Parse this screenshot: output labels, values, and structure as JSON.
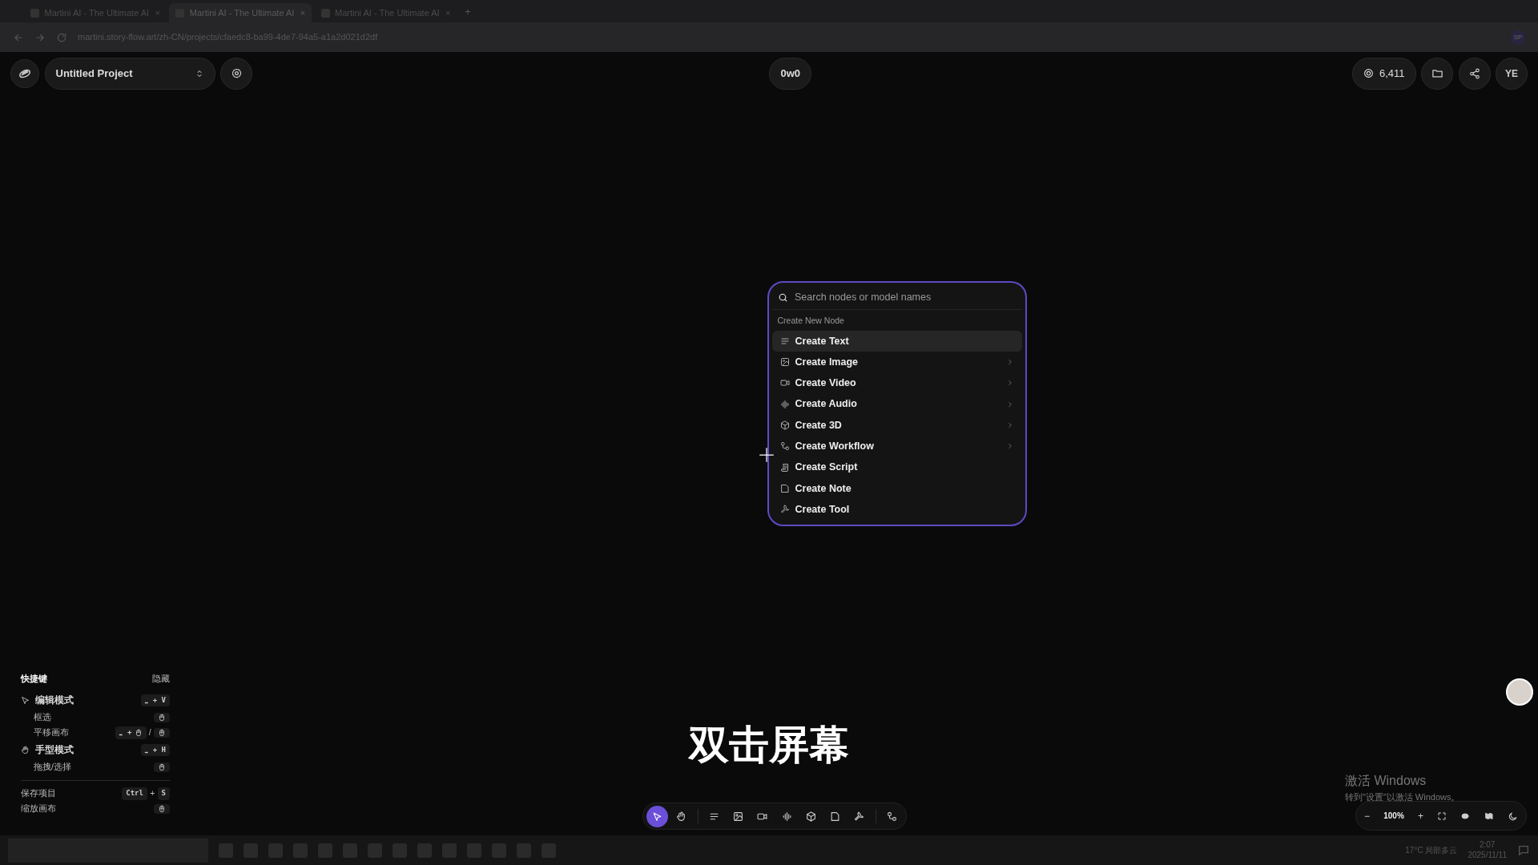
{
  "browser": {
    "tabs": [
      {
        "title": "Martini AI - The Ultimate AI",
        "close": "×",
        "selected": false
      },
      {
        "title": "Martini AI - The Ultimate AI",
        "close": "×",
        "selected": true
      },
      {
        "title": "Martini AI - The Ultimate AI",
        "close": "×",
        "selected": false
      }
    ],
    "new_tab": "+",
    "url": "martini.story-flow.art/zh-CN/projects/cfaedc8-ba99-4de7-94a5-a1a2d021d2df",
    "profile": "SP"
  },
  "header": {
    "project": "Untitled Project",
    "center_badge": "0w0",
    "credits": "6,411",
    "user": "YE"
  },
  "node_menu": {
    "placeholder": "Search nodes or model names",
    "section": "Create New Node",
    "items": [
      {
        "kind": "text",
        "label": "Create Text",
        "submenu": false,
        "selected": true
      },
      {
        "kind": "image",
        "label": "Create Image",
        "submenu": true,
        "selected": false
      },
      {
        "kind": "video",
        "label": "Create Video",
        "submenu": true,
        "selected": false
      },
      {
        "kind": "audio",
        "label": "Create Audio",
        "submenu": true,
        "selected": false
      },
      {
        "kind": "cube",
        "label": "Create 3D",
        "submenu": true,
        "selected": false
      },
      {
        "kind": "workflow",
        "label": "Create Workflow",
        "submenu": true,
        "selected": false
      },
      {
        "kind": "script",
        "label": "Create Script",
        "submenu": false,
        "selected": false
      },
      {
        "kind": "note",
        "label": "Create Note",
        "submenu": false,
        "selected": false
      },
      {
        "kind": "tool",
        "label": "Create Tool",
        "submenu": false,
        "selected": false
      }
    ]
  },
  "shortcuts": {
    "title": "快捷键",
    "hide": "隐藏",
    "rows": [
      {
        "kind": "pointer_mode",
        "label": "编辑模式",
        "keys": [
          {
            "kind": "box",
            "parts": [
              {
                "kind": "text",
                "text": "⎵ + V"
              }
            ]
          }
        ]
      },
      {
        "kind": "sub",
        "label": "框选",
        "keys": [
          {
            "kind": "box",
            "parts": [
              {
                "kind": "mouse"
              }
            ]
          }
        ]
      },
      {
        "kind": "sub",
        "label": "平移画布",
        "keys": [
          {
            "kind": "box",
            "parts": [
              {
                "kind": "text",
                "text": "⎵ +"
              },
              {
                "kind": "mouse"
              }
            ]
          },
          {
            "kind": "sep",
            "text": "/"
          },
          {
            "kind": "box",
            "parts": [
              {
                "kind": "scroll"
              }
            ]
          }
        ]
      },
      {
        "kind": "hand_mode",
        "label": "手型模式",
        "keys": [
          {
            "kind": "box",
            "parts": [
              {
                "kind": "text",
                "text": "⎵ + H"
              }
            ]
          }
        ]
      },
      {
        "kind": "sub",
        "label": "拖拽/选择",
        "keys": [
          {
            "kind": "box",
            "parts": [
              {
                "kind": "mouse"
              }
            ]
          }
        ]
      },
      {
        "kind": "divider"
      },
      {
        "kind": "plain",
        "label": "保存项目",
        "keys": [
          {
            "kind": "box",
            "parts": [
              {
                "kind": "text",
                "text": "Ctrl"
              }
            ]
          },
          {
            "kind": "sep",
            "text": "+"
          },
          {
            "kind": "box",
            "parts": [
              {
                "kind": "text",
                "text": "S"
              }
            ]
          }
        ]
      },
      {
        "kind": "plain",
        "label": "缩放画布",
        "keys": [
          {
            "kind": "box",
            "parts": [
              {
                "kind": "scroll"
              }
            ]
          }
        ]
      }
    ]
  },
  "caption": "双击屏幕",
  "toolbar": [
    {
      "kind": "pointer",
      "selected": true
    },
    {
      "kind": "hand",
      "selected": false
    },
    {
      "kind": "divider"
    },
    {
      "kind": "text",
      "selected": false
    },
    {
      "kind": "image",
      "selected": false
    },
    {
      "kind": "video",
      "selected": false
    },
    {
      "kind": "audio",
      "selected": false
    },
    {
      "kind": "cube",
      "selected": false
    },
    {
      "kind": "note",
      "selected": false
    },
    {
      "kind": "tool",
      "selected": false
    },
    {
      "kind": "divider"
    },
    {
      "kind": "workflow",
      "selected": false
    }
  ],
  "zoom": {
    "minus": "−",
    "level": "100%",
    "plus": "+"
  },
  "activation": {
    "title": "激活 Windows",
    "text": "转到\"设置\"以激活 Windows。"
  },
  "taskbar": {
    "weather": "17°C 局部多云",
    "time": "2:07",
    "date": "2025/11/11"
  }
}
